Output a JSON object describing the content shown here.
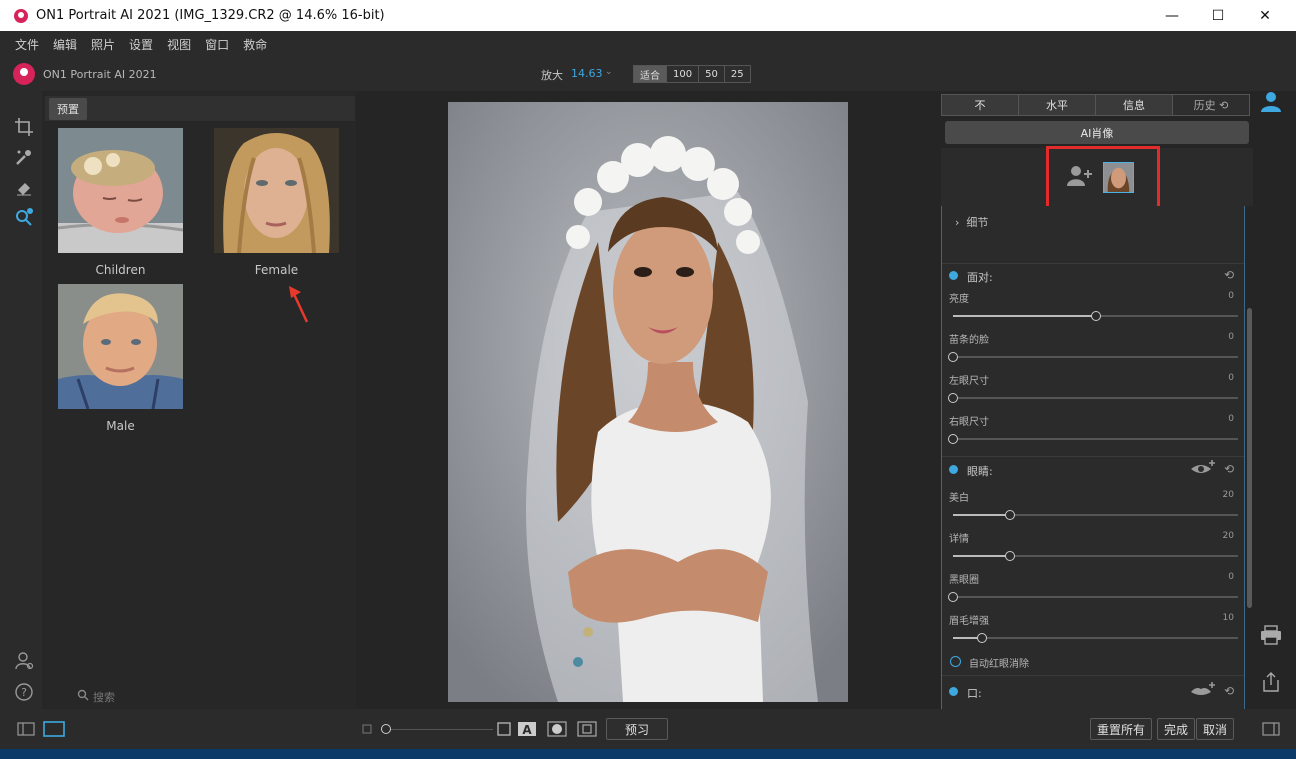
{
  "window": {
    "title": "ON1 Portrait AI 2021 (IMG_1329.CR2 @ 14.6% 16-bit)",
    "minimize": "—",
    "maximize": "☐",
    "close": "✕"
  },
  "menu": [
    "文件",
    "编辑",
    "照片",
    "设置",
    "视图",
    "窗口",
    "救命"
  ],
  "brand": {
    "name": "ON1 Portrait AI 2021"
  },
  "zoom": {
    "label": "放大",
    "value": "14.63",
    "buttons": [
      "适合",
      "100",
      "50",
      "25"
    ]
  },
  "presets": {
    "tab_label": "预置",
    "items": [
      {
        "name": "Children"
      },
      {
        "name": "Female"
      },
      {
        "name": "Male"
      }
    ],
    "search_placeholder": "搜索"
  },
  "right": {
    "tabs": [
      "不",
      "水平",
      "信息",
      "历史"
    ],
    "ai_button": "AI肖像",
    "detail_label": "细节",
    "face_section": {
      "title": "面对:",
      "sliders": [
        {
          "label": "亮度",
          "value": 0,
          "fraction": 0.5
        },
        {
          "label": "苗条的脸",
          "value": 0,
          "fraction": 0.0
        },
        {
          "label": "左眼尺寸",
          "value": 0,
          "fraction": 0.0
        },
        {
          "label": "右眼尺寸",
          "value": 0,
          "fraction": 0.0
        }
      ]
    },
    "eyes_section": {
      "title": "眼睛:",
      "sliders": [
        {
          "label": "美白",
          "value": 20,
          "fraction": 0.2
        },
        {
          "label": "详情",
          "value": 20,
          "fraction": 0.2
        },
        {
          "label": "黑眼圈",
          "value": 0,
          "fraction": 0.0
        },
        {
          "label": "眉毛增强",
          "value": 10,
          "fraction": 0.1
        }
      ],
      "checkbox": "自动红眼消除"
    },
    "mouth_section": {
      "title": "口:"
    }
  },
  "bottom": {
    "preview": "预习",
    "reset_all": "重置所有",
    "done": "完成",
    "cancel": "取消"
  }
}
